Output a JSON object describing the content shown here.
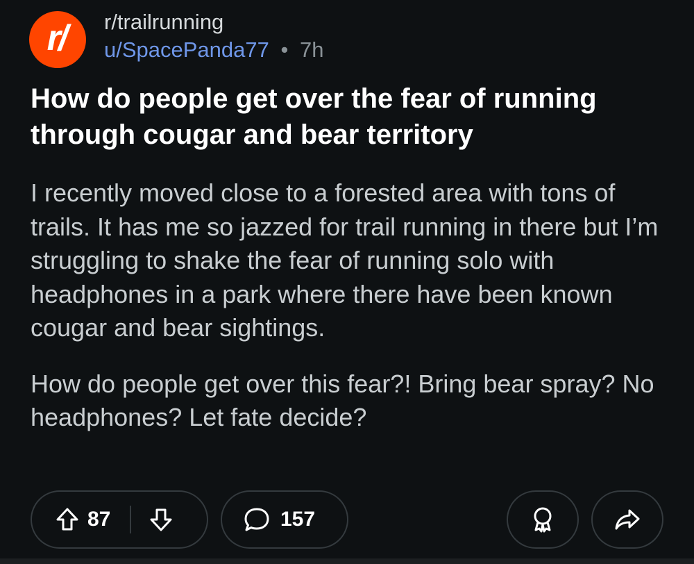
{
  "post": {
    "subreddit": "r/trailrunning",
    "avatar_text": "r/",
    "author": "u/SpacePanda77",
    "separator": "•",
    "age": "7h",
    "title": "How do people get over the fear of running through cougar and bear territory",
    "paragraphs": [
      "I recently moved close to a forested area with tons of trails. It has me so jazzed for trail running in there but I’m struggling to shake the fear of running solo with headphones in a park where there have been known cougar and bear sightings.",
      "How do people get over this fear?! Bring bear spray? No headphones? Let fate decide?"
    ]
  },
  "actions": {
    "votes": "87",
    "comments": "157",
    "icons": {
      "upvote": "upvote-arrow-icon",
      "downvote": "downvote-arrow-icon",
      "comment": "comment-bubble-icon",
      "award": "award-icon",
      "share": "share-arrow-icon"
    }
  },
  "colors": {
    "background": "#0e1113",
    "accent": "#ff4500",
    "username": "#6f97e9",
    "muted": "#8a9297",
    "pill_border": "#343a3e"
  }
}
